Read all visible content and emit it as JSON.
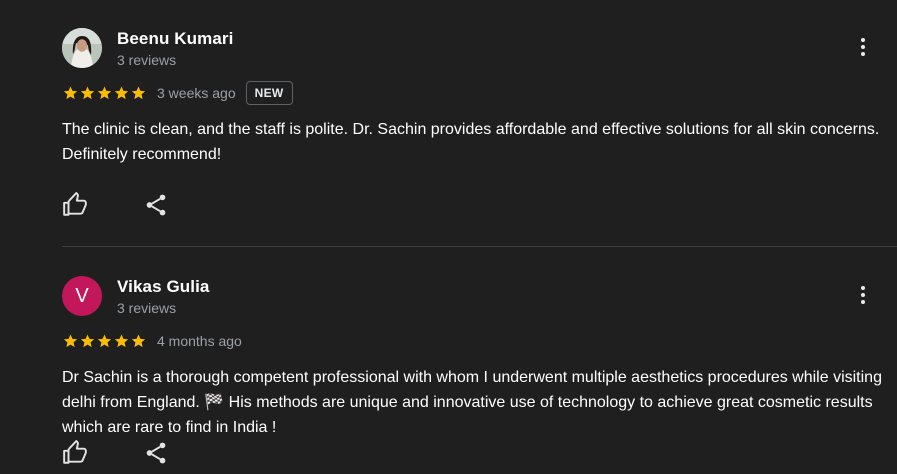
{
  "reviews": [
    {
      "name": "Beenu Kumari",
      "meta": "3 reviews",
      "rating": 5,
      "time": "3 weeks ago",
      "badge": "NEW",
      "avatar": "photo",
      "text": "The clinic is clean, and the staff is polite. Dr. Sachin provides affordable and effective solutions for all skin concerns. Definitely recommend!"
    },
    {
      "name": "Vikas Gulia",
      "meta": "3 reviews",
      "rating": 5,
      "time": "4 months ago",
      "avatar_letter": "V",
      "avatar_color": "#c2185b",
      "text": "Dr Sachin is a thorough competent professional with whom I underwent multiple aesthetics procedures while visiting delhi from England. 🏁 His methods are unique and innovative use of technology to achieve great cosmetic results which are rare to find in India !"
    }
  ],
  "colors": {
    "background": "#1f1f1f",
    "star": "#fbbc04",
    "secondary_text": "#9aa0a6"
  },
  "icons": [
    "more-vert-icon",
    "star-icon",
    "thumb-up-icon",
    "share-icon"
  ]
}
